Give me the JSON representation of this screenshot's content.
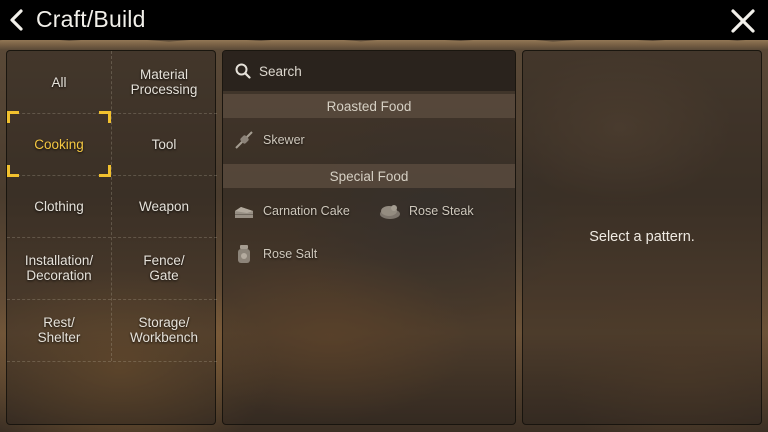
{
  "header": {
    "title": "Craft/Build"
  },
  "categories": [
    {
      "label": "All",
      "selected": false
    },
    {
      "label": "Material\nProcessing",
      "selected": false
    },
    {
      "label": "Cooking",
      "selected": true
    },
    {
      "label": "Tool",
      "selected": false
    },
    {
      "label": "Clothing",
      "selected": false
    },
    {
      "label": "Weapon",
      "selected": false
    },
    {
      "label": "Installation/\nDecoration",
      "selected": false
    },
    {
      "label": "Fence/\nGate",
      "selected": false
    },
    {
      "label": "Rest/\nShelter",
      "selected": false
    },
    {
      "label": "Storage/\nWorkbench",
      "selected": false
    }
  ],
  "search": {
    "placeholder": "Search"
  },
  "sections": [
    {
      "title": "Roasted Food",
      "items": [
        {
          "label": "Skewer",
          "icon": "skewer-icon"
        }
      ]
    },
    {
      "title": "Special Food",
      "items": [
        {
          "label": "Carnation Cake",
          "icon": "cake-icon"
        },
        {
          "label": "Rose Steak",
          "icon": "steak-icon"
        },
        {
          "label": "Rose Salt",
          "icon": "salt-jar-icon"
        }
      ]
    }
  ],
  "detail": {
    "hint": "Select a pattern."
  },
  "colors": {
    "selected_accent": "#f5c842",
    "bracket": "#f2c12e"
  }
}
